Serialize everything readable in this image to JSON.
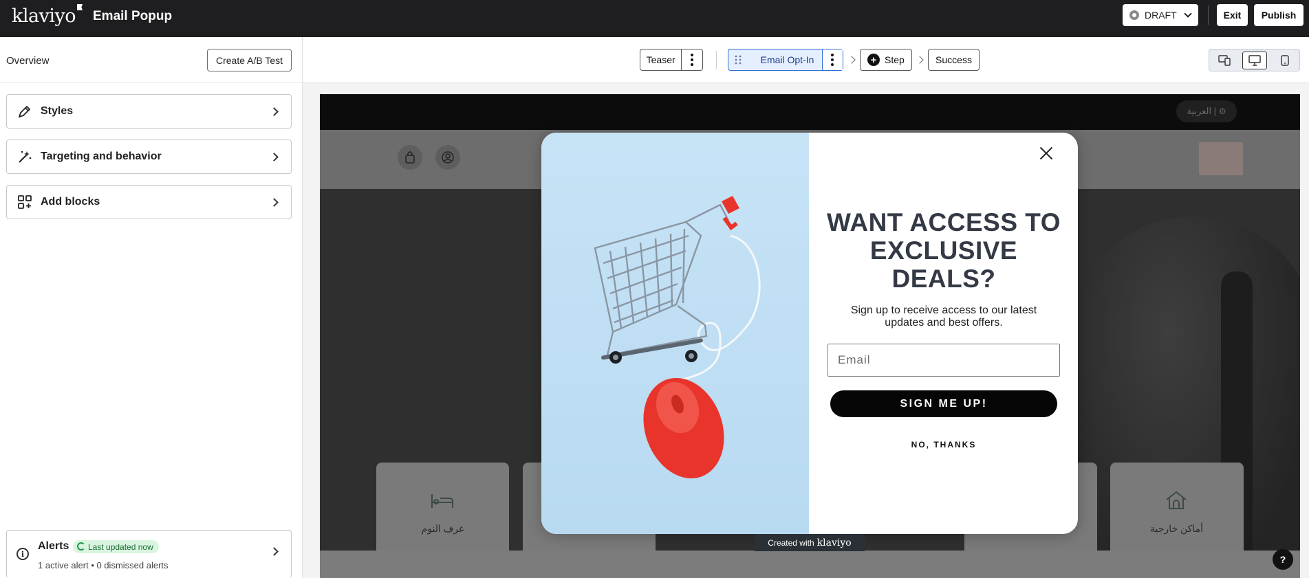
{
  "topbar": {
    "logo": "klaviyo",
    "title": "Email Popup",
    "status": "DRAFT",
    "exit_label": "Exit",
    "publish_label": "Publish"
  },
  "sidebar": {
    "overview_label": "Overview",
    "ab_test_label": "Create A/B Test",
    "items": [
      {
        "label": "Styles",
        "icon": "brush-icon"
      },
      {
        "label": "Targeting and behavior",
        "icon": "magic-wand-icon"
      },
      {
        "label": "Add blocks",
        "icon": "add-blocks-icon"
      }
    ],
    "alerts": {
      "title": "Alerts",
      "badge": "Last updated now",
      "summary": "1 active alert • 0 dismissed alerts"
    }
  },
  "steps": {
    "teaser": "Teaser",
    "email_optin": "Email Opt-In",
    "add_step": "Step",
    "success": "Success"
  },
  "site": {
    "language_toggle": "العربية |",
    "cards": [
      "غرف النوم",
      "أماكن خارجية"
    ]
  },
  "popup": {
    "headline": "WANT ACCESS TO EXCLUSIVE DEALS?",
    "subtext": "Sign up to receive access to our latest updates and best offers.",
    "email_placeholder": "Email",
    "submit_label": "SIGN ME UP!",
    "decline_label": "NO, THANKS",
    "created_with": "Created with",
    "created_with_brand": "klaviyo"
  },
  "help_label": "?",
  "colors": {
    "topbar": "#1e1e20",
    "active_step_bg": "#e6efff",
    "active_step_border": "#2e6bd8",
    "popup_button": "#050505",
    "cart_mouse": "#e8342b"
  }
}
